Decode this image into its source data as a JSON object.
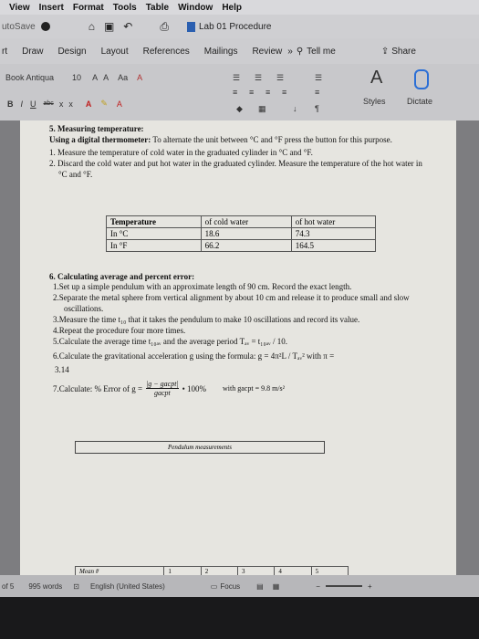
{
  "menubar": {
    "items": [
      "View",
      "Insert",
      "Format",
      "Tools",
      "Table",
      "Window",
      "Help"
    ]
  },
  "titlebar": {
    "autosave_label": "utoSave",
    "doc_title": "Lab 01 Procedure"
  },
  "tabs": {
    "items": [
      "rt",
      "Draw",
      "Design",
      "Layout",
      "References",
      "Mailings",
      "Review"
    ],
    "tell_me": "Tell me",
    "share": "Share"
  },
  "ribbon": {
    "font_name": "Book Antiqua",
    "font_size": "10",
    "styles_label": "Styles",
    "dictate_label": "Dictate",
    "bold": "B",
    "italic": "I",
    "underline": "U",
    "strike": "abc",
    "sub": "x",
    "sup": "x"
  },
  "document": {
    "s5_title": "5. Measuring temperature:",
    "s5_intro_bold": "Using a digital thermometer:",
    "s5_intro": "To alternate the unit between °C and °F press the button for this purpose.",
    "s5_steps": [
      "1.  Measure the temperature of cold water in the graduated cylinder in °C and °F.",
      "2.  Discard the cold water and put hot water in the graduated cylinder. Measure the temperature of the hot water in °C and °F."
    ],
    "table": {
      "headers": [
        "Temperature",
        "of cold water",
        "of hot water"
      ],
      "rows": [
        [
          "In °C",
          "18.6",
          "74.3"
        ],
        [
          "In °F",
          "66.2",
          "164.5"
        ]
      ]
    },
    "s6_title": "6. Calculating average and percent error:",
    "s6_steps": [
      "1.Set up a simple pendulum with an approximate length of 90 cm. Record the exact length.",
      "2.Separate the metal sphere from vertical alignment by about 10 cm and release it to produce small and slow oscillations.",
      "3.Measure the time t₁₀ that it takes the pendulum to make 10 oscillations and record its value.",
      "4.Repeat the procedure four more times.",
      "5.Calculate the average time t₁₀ₐᵥ and the average period Tₐᵥ = t₁₀ₐᵥ / 10.",
      "6.Calculate the gravitational acceleration g using the formula: g = 4π²L / Tₐᵥ²  with π ="
    ],
    "pi_value": "3.14",
    "s6_step7_prefix": "7.Calculate:  % Error of g =",
    "s6_step7_fraction_top": "|g − gacpt|",
    "s6_step7_fraction_bottom": "gacpt",
    "s6_step7_suffix": "• 100%",
    "s6_step7_with": "with gacpt = 9.8 m/s²",
    "pendulum_caption": "Pendulum measurements",
    "mean_table": [
      "Mean #",
      "1",
      "2",
      "3",
      "4",
      "5"
    ]
  },
  "statusbar": {
    "page": "of 5",
    "words": "995 words",
    "language": "English (United States)",
    "focus": "Focus"
  }
}
